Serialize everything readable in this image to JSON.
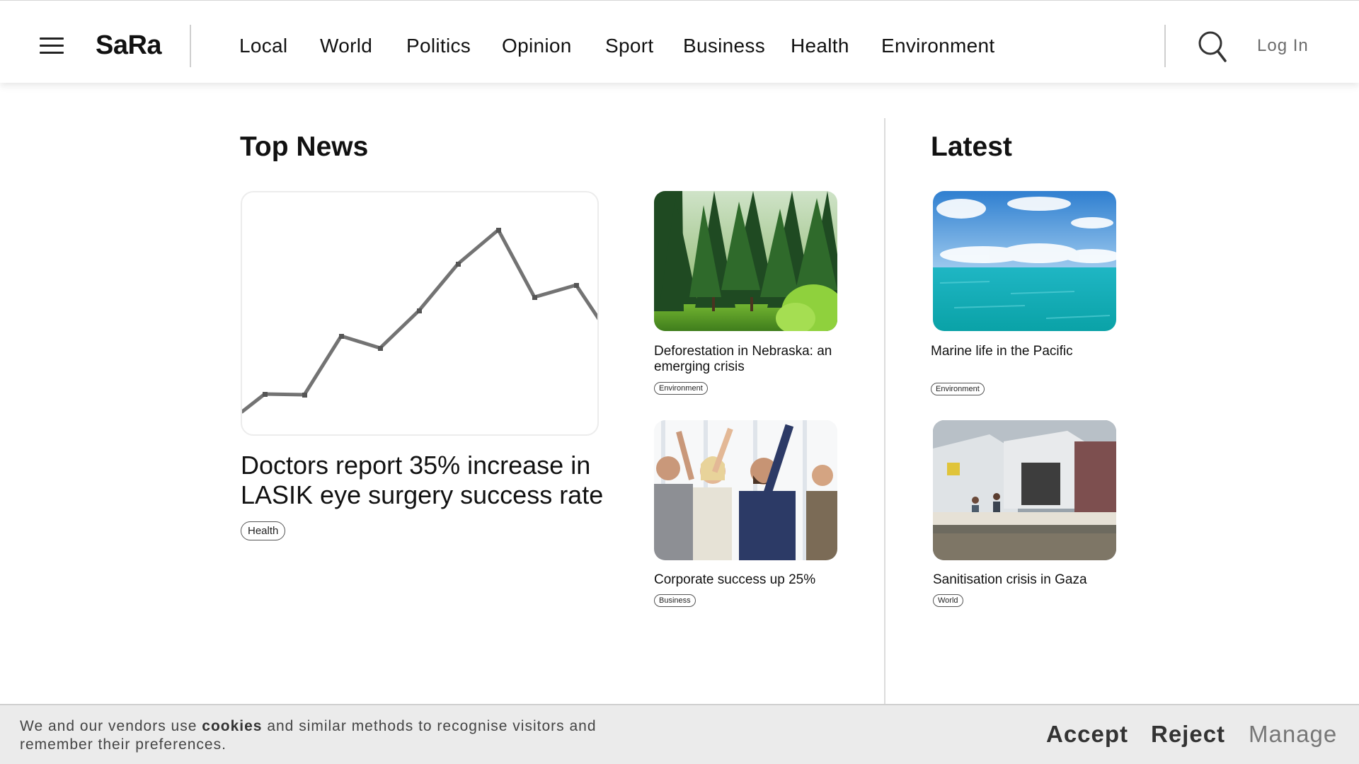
{
  "header": {
    "logo": "SaRa",
    "nav": [
      "Local",
      "World",
      "Politics",
      "Opinion",
      "Sport",
      "Business",
      "Health",
      "Environment"
    ],
    "login_label": "Log In"
  },
  "top_news": {
    "section_title": "Top News",
    "lead": {
      "headline": "Doctors report 35% increase in LASIK eye surgery success rate",
      "tag": "Health"
    },
    "stories": [
      {
        "title": "Deforestation in Nebraska: an emerging crisis",
        "tag": "Environment",
        "image": "pine-forest"
      },
      {
        "title": "Corporate success up 25%",
        "tag": "Business",
        "image": "celebrating-business-team"
      }
    ]
  },
  "latest": {
    "section_title": "Latest",
    "stories": [
      {
        "title": "Marine life in the Pacific",
        "tag": "Environment",
        "image": "turquoise-ocean"
      },
      {
        "title": "Sanitisation crisis in Gaza",
        "tag": "World",
        "image": "flooded-tent-camp"
      }
    ]
  },
  "cookie_banner": {
    "text_before": "We and our vendors use ",
    "text_bold": "cookies",
    "text_after": " and similar methods to recognise visitors and remember their preferences.",
    "accept_label": "Accept",
    "reject_label": "Reject",
    "manage_label": "Manage"
  },
  "colors": {
    "background": "#ffffff",
    "text": "#111111",
    "muted": "#6b6b6b",
    "banner": "#ebebeb"
  }
}
